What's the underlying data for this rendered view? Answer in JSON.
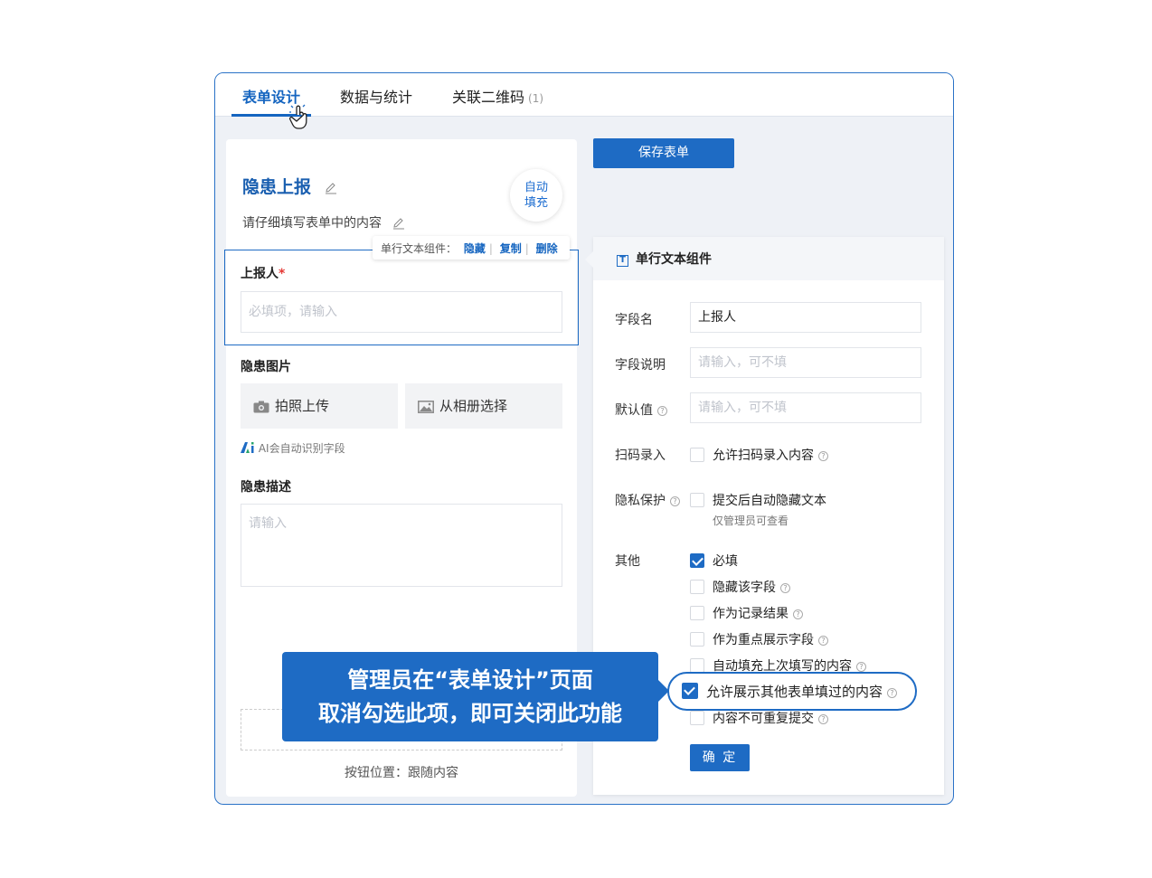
{
  "tabs": [
    {
      "label": "表单设计",
      "active": true
    },
    {
      "label": "数据与统计"
    },
    {
      "label": "关联二维码",
      "count": "(1)"
    }
  ],
  "form": {
    "title": "隐患上报",
    "subtitle": "请仔细填写表单中的内容",
    "autofill_line1": "自动",
    "autofill_line2": "填充",
    "component_toolbar": {
      "label": "单行文本组件：",
      "hide": "隐藏",
      "copy": "复制",
      "delete": "删除"
    },
    "fields": {
      "reporter_label": "上报人",
      "reporter_required_mark": "*",
      "reporter_placeholder": "必填项，请输入",
      "photo_label": "隐患图片",
      "take_photo": "拍照上传",
      "from_album": "从相册选择",
      "ai_hint": "AI会自动识别字段",
      "desc_label": "隐患描述",
      "desc_placeholder": "请输入"
    },
    "button_position": "按钮位置：跟随内容"
  },
  "save_button": "保存表单",
  "panel": {
    "title": "单行文本组件",
    "field_name_label": "字段名",
    "field_name_value": "上报人",
    "field_desc_label": "字段说明",
    "field_desc_placeholder": "请输入，可不填",
    "default_label": "默认值",
    "default_placeholder": "请输入，可不填",
    "scan_label": "扫码录入",
    "scan_option": "允许扫码录入内容",
    "privacy_label": "隐私保护",
    "privacy_option": "提交后自动隐藏文本",
    "privacy_note": "仅管理员可查看",
    "other_label": "其他",
    "options": [
      {
        "label": "必填",
        "checked": true,
        "help": false
      },
      {
        "label": "隐藏该字段",
        "checked": false,
        "help": true
      },
      {
        "label": "作为记录结果",
        "checked": false,
        "help": true
      },
      {
        "label": "作为重点展示字段",
        "checked": false,
        "help": true
      },
      {
        "label": "自动填充上次填写的内容",
        "checked": false,
        "help": true
      },
      {
        "label": "允许展示其他表单填过的内容",
        "checked": true,
        "help": true
      },
      {
        "label": "内容不可重复提交",
        "checked": false,
        "help": true
      }
    ],
    "confirm": "确 定"
  },
  "callout": {
    "line1": "管理员在“表单设计”页面",
    "line2": "取消勾选此项，即可关闭此功能"
  },
  "colors": {
    "accent": "#1e6bc4",
    "tab_active": "#1565c0",
    "required": "#e53935"
  }
}
